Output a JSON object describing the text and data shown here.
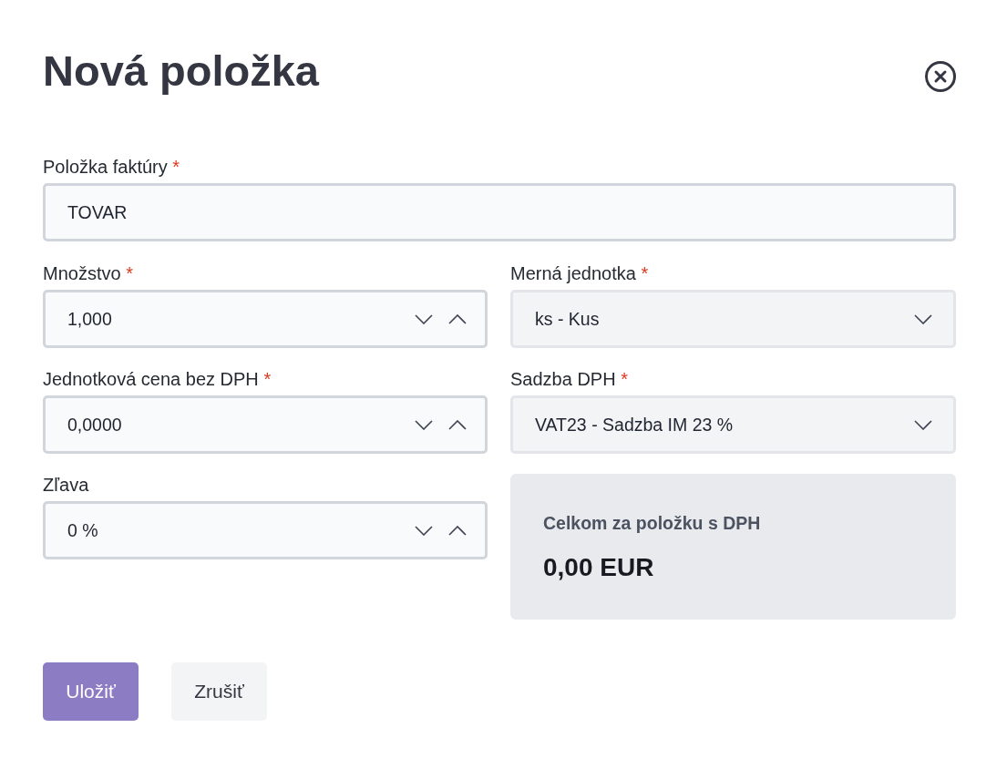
{
  "dialog": {
    "title": "Nová položka"
  },
  "item_field": {
    "kind": "text",
    "label": "Položka faktúry",
    "required_mark": "*",
    "value": "TOVAR"
  },
  "fields": [
    {
      "kind": "number",
      "label": "Množstvo",
      "required_mark": "*",
      "value": "1,000"
    },
    {
      "kind": "select",
      "label": "Merná jednotka",
      "required_mark": "*",
      "value": "ks - Kus"
    },
    {
      "kind": "number",
      "label": "Jednotková cena bez DPH",
      "required_mark": "*",
      "value": "0,0000"
    },
    {
      "kind": "select",
      "label": "Sadzba DPH",
      "required_mark": "*",
      "value": "VAT23 - Sadzba IM 23 %"
    },
    {
      "kind": "number",
      "label": "Zľava",
      "value": "0 %"
    }
  ],
  "total": {
    "label": "Celkom za položku s DPH",
    "value": "0,00 EUR"
  },
  "buttons": [
    {
      "kind": "primary",
      "label": "Uložiť"
    },
    {
      "kind": "secondary",
      "label": "Zrušiť"
    }
  ]
}
